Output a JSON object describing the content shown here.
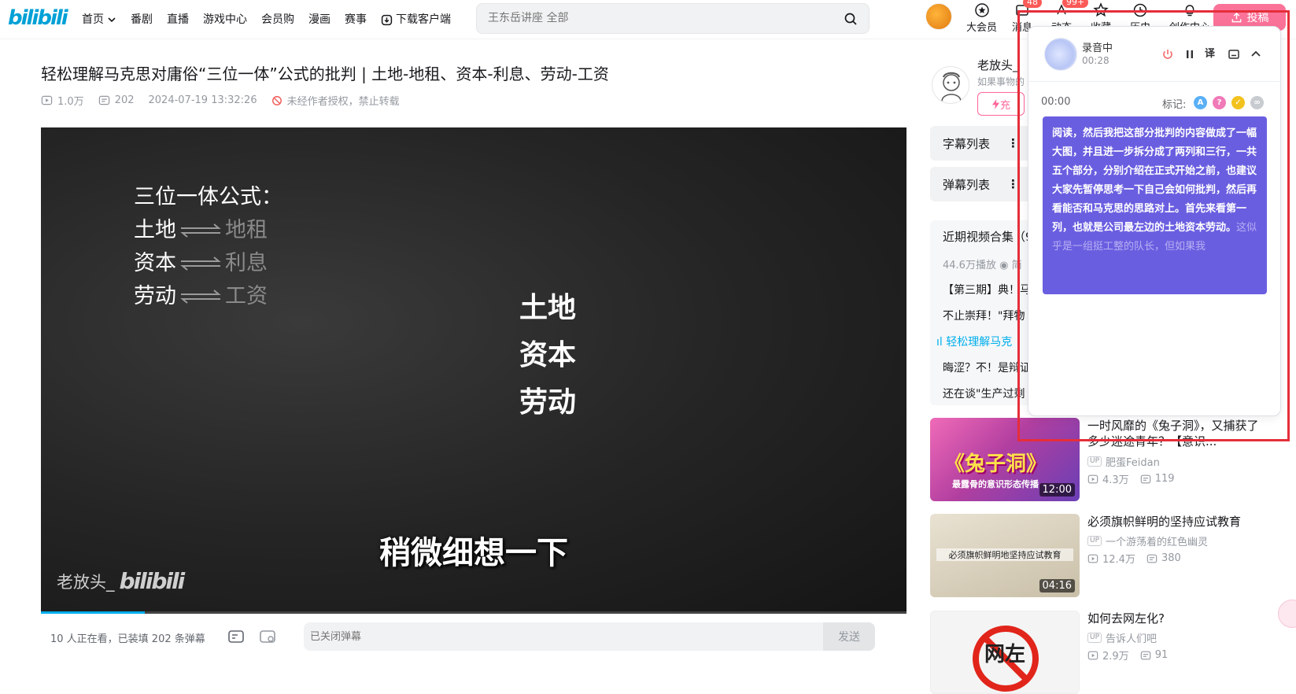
{
  "header": {
    "logo": "bilibili",
    "nav": [
      "首页",
      "番剧",
      "直播",
      "游戏中心",
      "会员购",
      "漫画",
      "赛事",
      "下载客户端"
    ],
    "search_placeholder": "王东岳讲座 全部",
    "icons": [
      {
        "label": "大会员",
        "badge": ""
      },
      {
        "label": "消息",
        "badge": "48"
      },
      {
        "label": "动态",
        "badge": "99+"
      },
      {
        "label": "收藏",
        "badge": ""
      },
      {
        "label": "历史",
        "badge": ""
      },
      {
        "label": "创作中心",
        "badge": ""
      }
    ],
    "upload_label": "投稿"
  },
  "video": {
    "title": "轻松理解马克思对庸俗“三位一体”公式的批判 | 土地-地租、资本-利息、劳动-工资",
    "views": "1.0万",
    "danmaku_count": "202",
    "date": "2024-07-19 13:32:26",
    "rights": "未经作者授权，禁止转载",
    "frame": {
      "formula_title": "三位一体公式：",
      "rows": [
        {
          "left": "土地",
          "right": "地租"
        },
        {
          "left": "资本",
          "right": "利息"
        },
        {
          "left": "劳动",
          "right": "工资"
        }
      ],
      "center_words": [
        "土地",
        "资本",
        "劳动"
      ],
      "subtitle": "稍微细想一下",
      "watermark_name": "老放头_",
      "watermark_logo": "bilibili"
    },
    "progress": 0.12
  },
  "danmaku_bar": {
    "watching": "10 人正在看，已装填 202 条弹幕",
    "placeholder": "已关闭弹幕",
    "send_label": "发送"
  },
  "uploader": {
    "name": "老放头_",
    "desc": "如果事物的",
    "charge_label": "充"
  },
  "panels": {
    "subtitle_list": "字幕列表",
    "danmaku_list": "弹幕列表"
  },
  "collection": {
    "title": "近期视频合集（9",
    "plays": "44.6万播放",
    "plays_suffix": "简",
    "items": [
      "【第三期】典！马",
      "不止崇拜！\"拜物",
      "轻松理解马克",
      "晦涩？不！是辩证",
      "还在谈\"生产过剩"
    ],
    "active_index": 2
  },
  "recommendations": [
    {
      "title": "一时风靡的《兔子洞》，又捕获了多少迷途青年？【意识...",
      "up": "肥蛋Feidan",
      "views": "4.3万",
      "comments": "119",
      "duration": "12:00",
      "thumb_text": "《兔子洞》",
      "thumb_sub": "最露骨的意识形态传播"
    },
    {
      "title": "必须旗帜鲜明的坚持应试教育",
      "up": "一个游荡着的红色幽灵",
      "views": "12.4万",
      "comments": "380",
      "duration": "04:16",
      "thumb_text": "必须旗帜鲜明地坚持应试教育"
    },
    {
      "title": "如何去网左化?",
      "up": "告诉人们吧",
      "views": "2.9万",
      "comments": "91",
      "duration": "",
      "thumb_text": "网左"
    }
  ],
  "recorder": {
    "status": "录音中",
    "elapsed": "00:28",
    "timestamp": "00:00",
    "marks_label": "标记:",
    "transcript_bold": "阅读，然后我把这部分批判的内容做成了一幅大图，并且进一步拆分成了两列和三行，一共五个部分，分别介绍在正式开始之前，也建议大家先暂停思考一下自己会如何批判，然后再看能否和马克思的思路对上。首先来看第一列，也就是公司最左边的土地资本劳动。",
    "transcript_faded": "这似乎是一组挺工整的队长，但如果我"
  },
  "colors": {
    "brand_blue": "#00aeec",
    "brand_pink": "#fb7299",
    "recorder_purple": "#6a5ee0",
    "overlay_red": "#e52e3a"
  }
}
